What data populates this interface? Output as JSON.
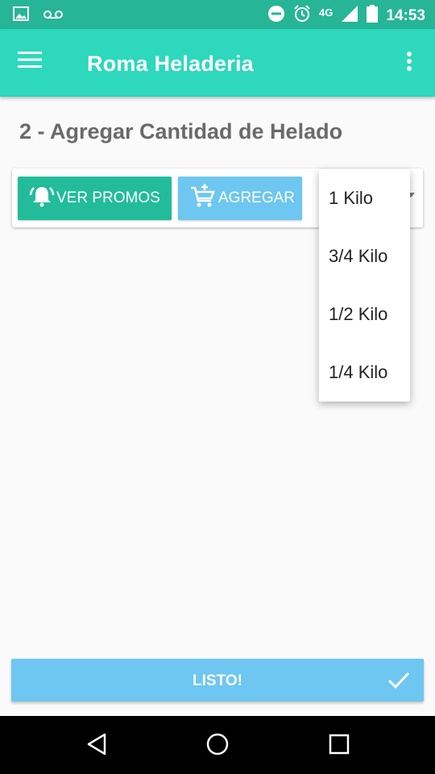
{
  "status_bar": {
    "network": "4G",
    "time": "14:53",
    "icons": [
      "image-icon",
      "voicemail-icon",
      "do-not-disturb-icon",
      "alarm-icon",
      "signal-icon",
      "battery-icon"
    ]
  },
  "app_bar": {
    "title": "Roma Heladeria",
    "menu_icon": "hamburger-icon",
    "overflow_icon": "more-vert-icon"
  },
  "section_title": "2 - Agregar Cantidad de Helado",
  "actions": {
    "promos_label": "VER PROMOS",
    "promos_icon": "bell-ringing-icon",
    "agregar_label": "AGREGAR",
    "agregar_icon": "cart-add-icon"
  },
  "quantity_dropdown": {
    "options": [
      "1 Kilo",
      "3/4 Kilo",
      "1/2 Kilo",
      "1/4 Kilo"
    ]
  },
  "footer": {
    "listo_label": "LISTO!",
    "listo_icon": "check-icon"
  },
  "colors": {
    "status_bar": "#26b596",
    "app_bar": "#2dd8bc",
    "promos_button": "#22bc9b",
    "agregar_button": "#6dc7f0",
    "listo_button": "#6dc7f0"
  }
}
